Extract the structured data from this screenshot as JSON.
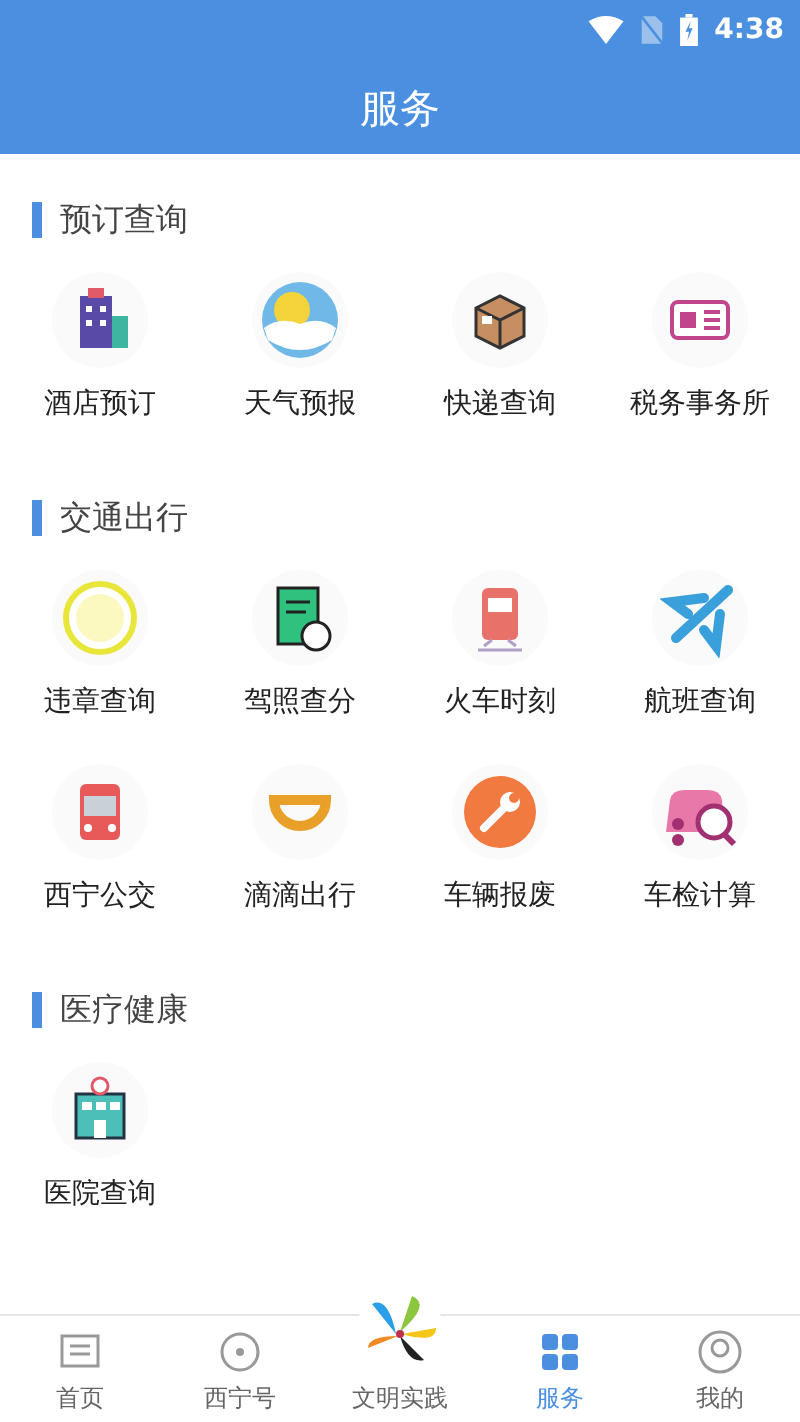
{
  "status_bar": {
    "time": "4:38"
  },
  "header": {
    "title": "服务"
  },
  "sections": [
    {
      "title": "预订查询",
      "items": [
        {
          "label": "酒店预订"
        },
        {
          "label": "天气预报"
        },
        {
          "label": "快递查询"
        },
        {
          "label": "税务事务所"
        }
      ]
    },
    {
      "title": "交通出行",
      "items": [
        {
          "label": "违章查询"
        },
        {
          "label": "驾照查分"
        },
        {
          "label": "火车时刻"
        },
        {
          "label": "航班查询"
        },
        {
          "label": "西宁公交"
        },
        {
          "label": "滴滴出行"
        },
        {
          "label": "车辆报废"
        },
        {
          "label": "车检计算"
        }
      ]
    },
    {
      "title": "医疗健康",
      "items": [
        {
          "label": "医院查询"
        }
      ]
    }
  ],
  "bottom_nav": [
    {
      "label": "首页",
      "selected": false
    },
    {
      "label": "西宁号",
      "selected": false
    },
    {
      "label": "文明实践",
      "selected": false
    },
    {
      "label": "服务",
      "selected": true
    },
    {
      "label": "我的",
      "selected": false
    }
  ]
}
